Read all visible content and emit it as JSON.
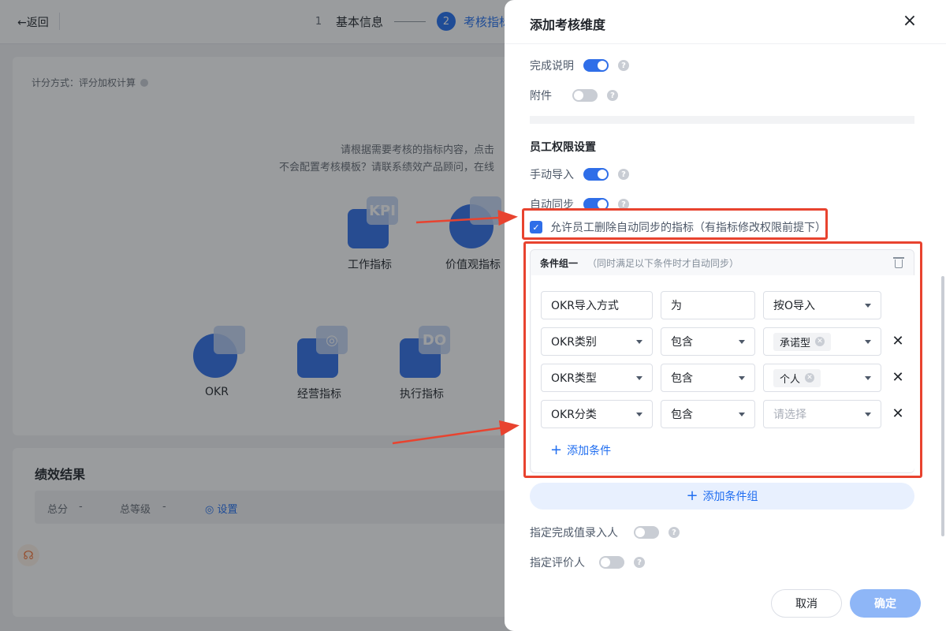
{
  "background": {
    "back_label": "←返回",
    "steps": [
      {
        "num": "1",
        "label": "基本信息"
      },
      {
        "num": "2",
        "label": "考核指标"
      }
    ],
    "score_mode": "计分方式：评分加权计算",
    "hint_line1": "请根据需要考核的指标内容，点击",
    "hint_line2": "不会配置考核模板？请联系绩效产品顾问，在线",
    "templates_row1": [
      {
        "name": "工作指标",
        "glass": "KPI"
      },
      {
        "name": "价值观指标",
        "glass": ""
      }
    ],
    "templates_row2": [
      {
        "name": "OKR",
        "glass": ""
      },
      {
        "name": "经营指标",
        "glass": "◎"
      },
      {
        "name": "执行指标",
        "glass": "DO"
      }
    ],
    "result": {
      "title": "绩效结果",
      "total_label": "总分",
      "total_value": "-",
      "grade_label": "总等级",
      "grade_value": "-",
      "settings_label": "◎ 设置"
    }
  },
  "drawer": {
    "title": "添加考核维度",
    "close_icon": "×",
    "completion_label": "完成说明",
    "attachment_label": "附件",
    "employee_perm_title": "员工权限设置",
    "manual_import_label": "手动导入",
    "auto_sync_label": "自动同步",
    "allow_delete_label": "允许员工删除自动同步的指标（有指标修改权限前提下）",
    "condition_group": {
      "name": "条件组一",
      "desc": "（同时满足以下条件时才自动同步）",
      "rows": [
        {
          "field": "OKR导入方式",
          "field_dropdown": false,
          "op": "为",
          "op_dropdown": false,
          "value": "按O导入",
          "value_is_tag": false,
          "placeholder": false,
          "removable": false
        },
        {
          "field": "OKR类别",
          "field_dropdown": true,
          "op": "包含",
          "op_dropdown": true,
          "value": "承诺型",
          "value_is_tag": true,
          "placeholder": false,
          "removable": true
        },
        {
          "field": "OKR类型",
          "field_dropdown": true,
          "op": "包含",
          "op_dropdown": true,
          "value": "个人",
          "value_is_tag": true,
          "placeholder": false,
          "removable": true
        },
        {
          "field": "OKR分类",
          "field_dropdown": true,
          "op": "包含",
          "op_dropdown": true,
          "value": "请选择",
          "value_is_tag": false,
          "placeholder": true,
          "removable": true
        }
      ],
      "add_condition_label": "添加条件"
    },
    "add_group_label": "添加条件组",
    "assign_completion_label": "指定完成值录入人",
    "assign_reviewer_label": "指定评价人",
    "cancel_label": "取消",
    "confirm_label": "确定"
  },
  "colors": {
    "accent": "#1f6df0",
    "annotation": "#e8432f"
  }
}
